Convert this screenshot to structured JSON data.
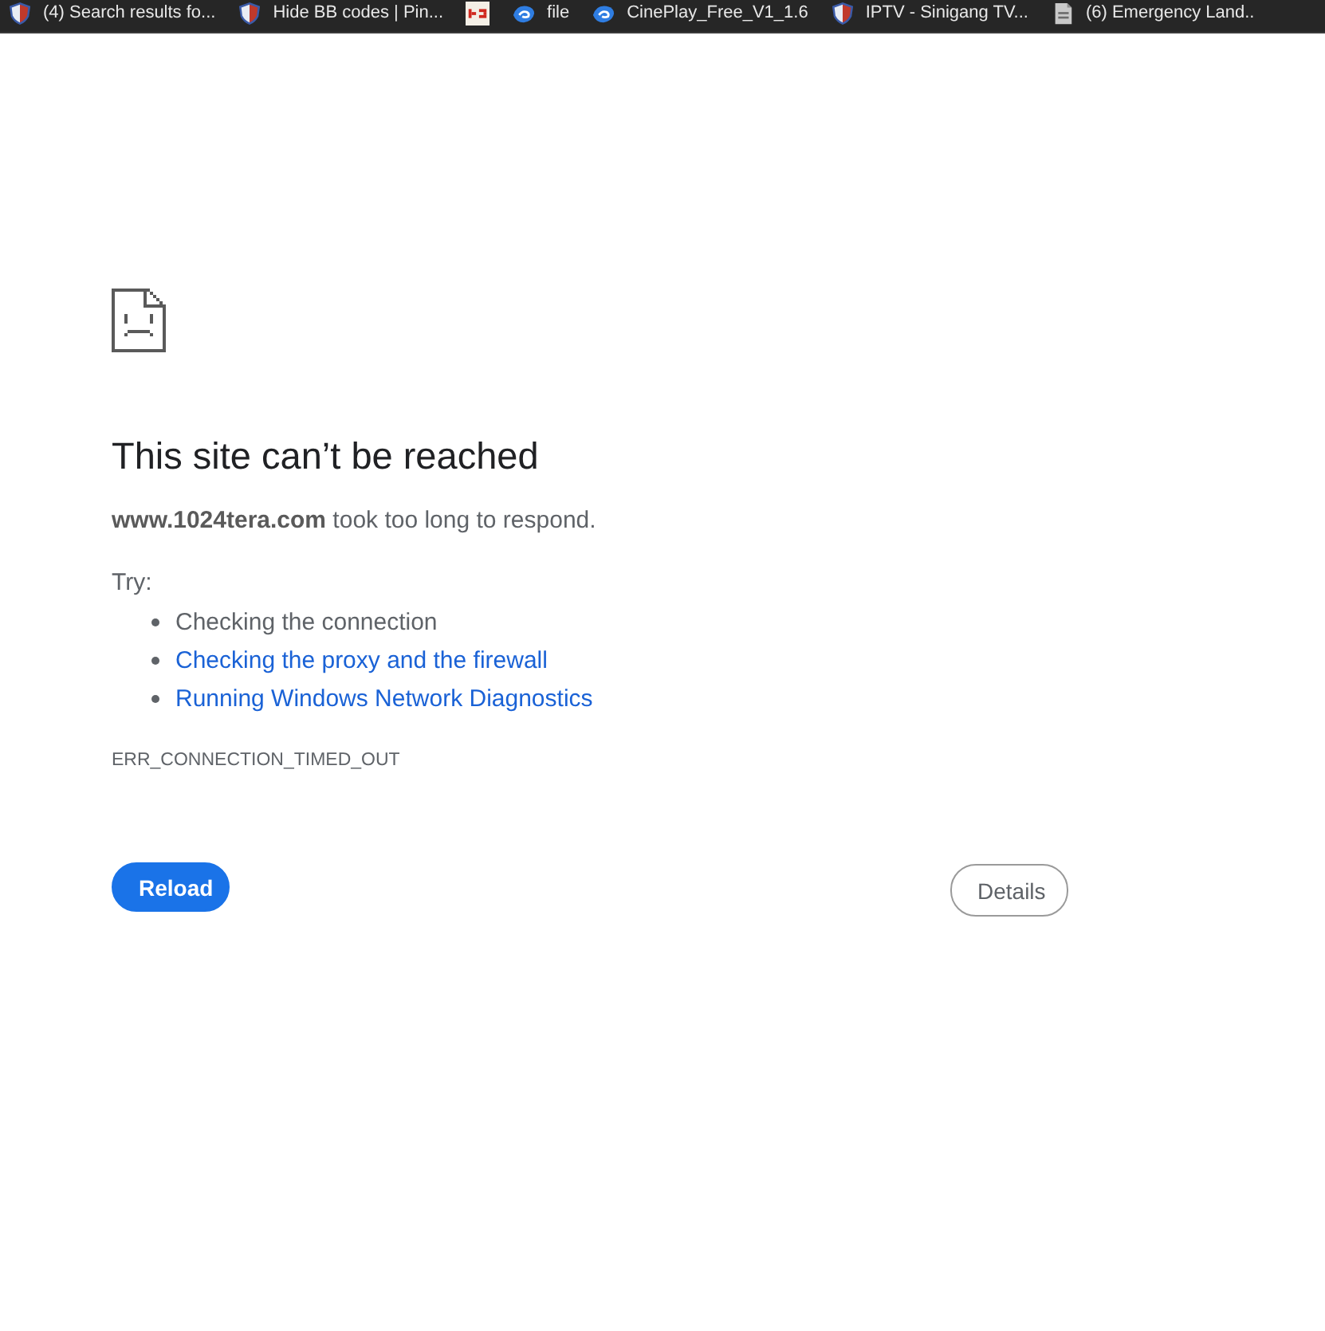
{
  "bookmarks_bar": {
    "items": [
      {
        "kind": "shield",
        "label": "(4) Search results fo..."
      },
      {
        "kind": "shield",
        "label": "Hide BB codes | Pin..."
      },
      {
        "kind": "tile"
      },
      {
        "kind": "swirl",
        "label": "file"
      },
      {
        "kind": "swirl",
        "label": "CinePlay_Free_V1_1.6"
      },
      {
        "kind": "shield",
        "label": "IPTV - Sinigang TV..."
      },
      {
        "kind": "page",
        "label": "(6) Emergency Land.."
      }
    ]
  },
  "error_page": {
    "title": "This site can’t be reached",
    "message": "**www.1024tera.com** took too long to respond.",
    "try_label": "Try:",
    "suggestions": [
      {
        "kind": "text",
        "text": "Checking the connection"
      },
      {
        "kind": "link",
        "text": "Checking the proxy and the firewall"
      },
      {
        "kind": "link",
        "text": "Running Windows Network Diagnostics"
      }
    ],
    "error_code": "ERR_CONNECTION_TIMED_OUT",
    "buttons": [
      {
        "kind": "primary",
        "label": "Reload"
      },
      {
        "kind": "secondary",
        "label": "Details"
      }
    ]
  }
}
